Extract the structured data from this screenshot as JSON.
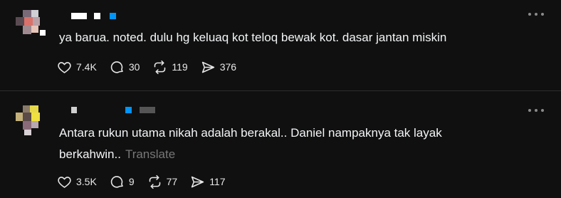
{
  "posts": [
    {
      "text": "ya barua. noted. dulu hg keluaq kot teloq bewak kot. dasar jantan miskin",
      "translate": "",
      "likes": "7.4K",
      "replies": "30",
      "reposts": "119",
      "shares": "376",
      "icons": [
        "heart-icon",
        "comment-icon",
        "repost-icon",
        "share-icon",
        "more-icon"
      ]
    },
    {
      "text_line1": "Antara rukun utama nikah adalah berakal.. Daniel nampaknya tak layak",
      "text_line2": "berkahwin..",
      "translate": "Translate",
      "likes": "3.5K",
      "replies": "9",
      "reposts": "77",
      "shares": "117",
      "icons": [
        "heart-icon",
        "comment-icon",
        "repost-icon",
        "share-icon",
        "more-icon"
      ]
    }
  ],
  "colors": {
    "background": "#101010",
    "text": "#f3f5f7",
    "muted": "#777777",
    "verified": "#0095f6"
  }
}
